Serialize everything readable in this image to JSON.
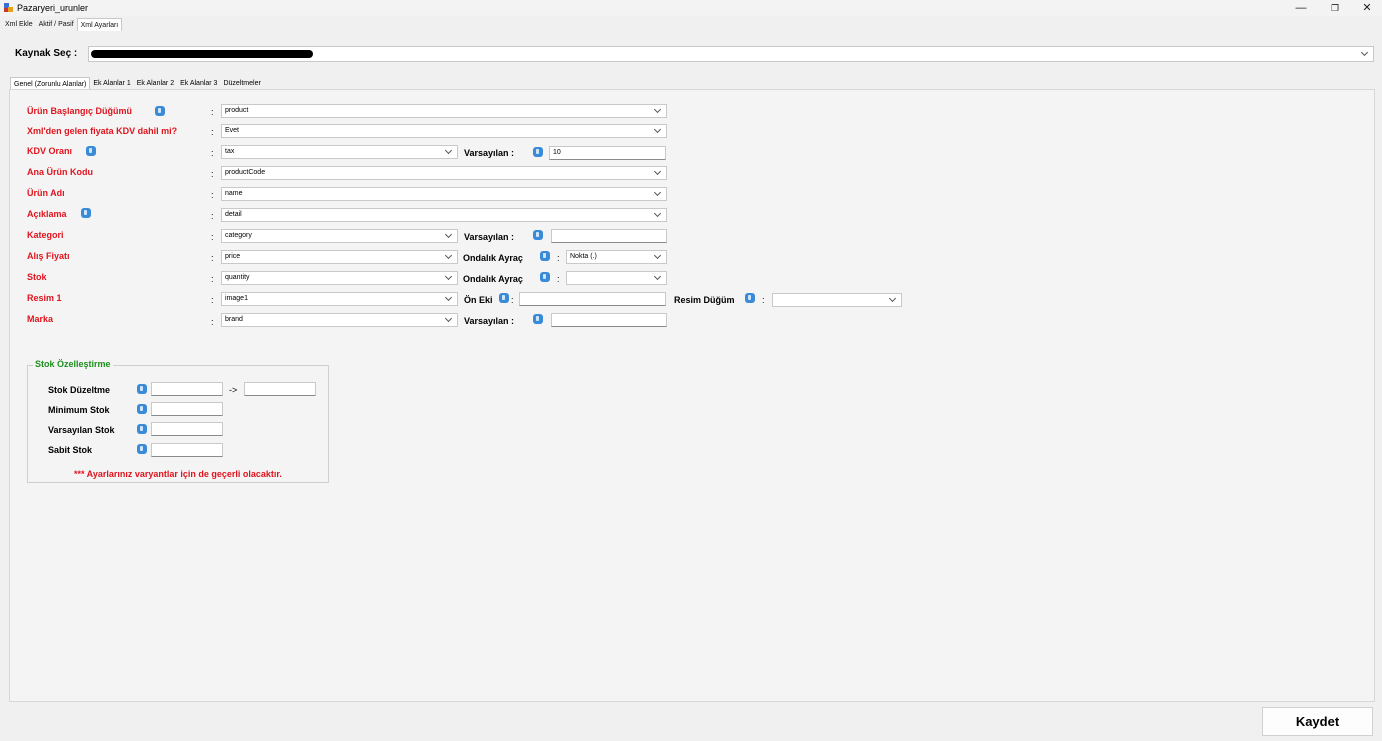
{
  "window": {
    "title": "Pazaryeri_urunler",
    "controls": {
      "minimize": "—",
      "maximize": "❐",
      "close": "✕"
    }
  },
  "top_tabs": [
    "Xml Ekle",
    "Aktif / Pasif",
    "Xml Ayarları"
  ],
  "kaynak": {
    "label": "Kaynak Seç :"
  },
  "inner_tabs": [
    "Genel (Zorunlu Alanlar)",
    "Ek Alanlar 1",
    "Ek Alanlar 2",
    "Ek Alanlar 3",
    "Düzeltmeler"
  ],
  "fields": {
    "urun_baslangic": {
      "label": "Ürün Başlangıç Düğümü",
      "value": "product"
    },
    "kdv_dahil": {
      "label": "Xml'den gelen fiyata KDV dahil mi?",
      "value": "Evet"
    },
    "kdv_orani": {
      "label": "KDV Oranı",
      "value": "tax",
      "default_label": "Varsayılan :",
      "default_value": "10"
    },
    "ana_urun_kodu": {
      "label": "Ana Ürün Kodu",
      "value": "productCode"
    },
    "urun_adi": {
      "label": "Ürün Adı",
      "value": "name"
    },
    "aciklama": {
      "label": "Açıklama",
      "value": "detail"
    },
    "kategori": {
      "label": "Kategori",
      "value": "category",
      "default_label": "Varsayılan :",
      "default_value": ""
    },
    "alis_fiyati": {
      "label": "Alış Fiyatı",
      "value": "price",
      "sep_label": "Ondalık Ayraç",
      "sep_value": "Nokta (.)"
    },
    "stok": {
      "label": "Stok",
      "value": "quantity",
      "sep_label": "Ondalık Ayraç",
      "sep_value": ""
    },
    "resim1": {
      "label": "Resim 1",
      "value": "image1",
      "prefix_label": "Ön Eki",
      "prefix_value": "",
      "node_label": "Resim Düğüm",
      "node_value": ""
    },
    "marka": {
      "label": "Marka",
      "value": "brand",
      "default_label": "Varsayılan :",
      "default_value": ""
    }
  },
  "colon": ":",
  "stok_group": {
    "title": "Stok Özelleştirme",
    "duzeltme_label": "Stok Düzeltme",
    "arrow": "->",
    "minimum_label": "Minimum Stok",
    "varsayilan_label": "Varsayılan Stok",
    "sabit_label": "Sabit Stok",
    "warning": "*** Ayarlarınız varyantlar için de geçerli olacaktır."
  },
  "save_label": "Kaydet",
  "colors": {
    "required": "#e0141e",
    "group_title": "#1e8f1e",
    "help_icon": "#3a8bd7"
  }
}
